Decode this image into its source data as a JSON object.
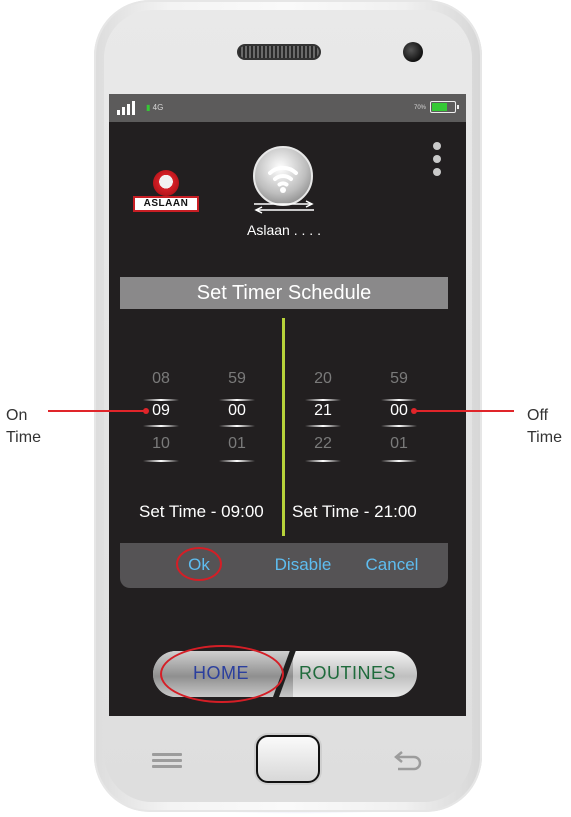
{
  "status_bar": {
    "network": "4G",
    "battery_percent": "70%",
    "battery_level": 0.7
  },
  "header": {
    "brand": "ASLAAN",
    "device_name": "Aslaan . . . ."
  },
  "timer": {
    "title": "Set Timer Schedule",
    "on": {
      "hour_prev": "08",
      "hour": "09",
      "hour_next": "10",
      "min_prev": "59",
      "min": "00",
      "min_next": "01",
      "set_label": "Set Time - 09:00"
    },
    "off": {
      "hour_prev": "20",
      "hour": "21",
      "hour_next": "22",
      "min_prev": "59",
      "min": "00",
      "min_next": "01",
      "set_label": "Set Time - 21:00"
    }
  },
  "actions": {
    "ok": "Ok",
    "disable": "Disable",
    "cancel": "Cancel"
  },
  "tabs": {
    "home": "HOME",
    "routines": "ROUTINES"
  },
  "callouts": {
    "on_line1": "On",
    "on_line2": "Time",
    "off_line1": "Off",
    "off_line2": "Time"
  },
  "icons": [
    "signal-icon",
    "battery-icon",
    "more-vert-icon",
    "brand-logo",
    "wifi-icon",
    "transfer-arrows-icon",
    "menu-key-icon",
    "home-key",
    "back-key-icon"
  ],
  "colors": {
    "accent_blue": "#5ebdf0",
    "divider_green": "#b7d23a",
    "highlight_red": "#d51e26",
    "home_tab_text": "#2b3f9e",
    "routines_tab_text": "#1f6b3c"
  }
}
